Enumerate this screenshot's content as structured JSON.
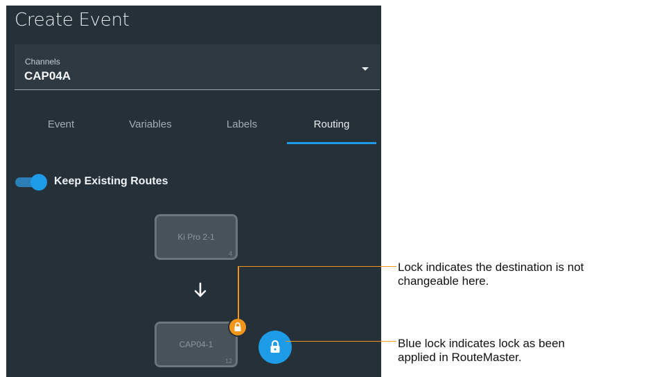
{
  "panel": {
    "title": "Create Event",
    "channels": {
      "label": "Channels",
      "value": "CAP04A"
    },
    "tabs": [
      {
        "label": "Event",
        "active": false
      },
      {
        "label": "Variables",
        "active": false
      },
      {
        "label": "Labels",
        "active": false
      },
      {
        "label": "Routing",
        "active": true
      }
    ],
    "keep_routes": {
      "label": "Keep Existing Routes",
      "on": true
    },
    "routing": {
      "source": {
        "label": "Ki Pro 2-1",
        "number": "4"
      },
      "destination": {
        "label": "CAP04-1",
        "number": "12"
      }
    }
  },
  "callouts": {
    "orange_lock": {
      "line1": "Lock indicates the destination is not",
      "line2": "changeable here."
    },
    "blue_lock": {
      "line1": "Blue lock indicates lock as been",
      "line2": "applied in RouteMaster."
    }
  },
  "colors": {
    "accent_blue": "#1e9be6",
    "lock_orange": "#f39519",
    "panel_bg": "#263038"
  },
  "icons": [
    "chevron-down-icon",
    "arrow-down-icon",
    "lock-icon"
  ]
}
